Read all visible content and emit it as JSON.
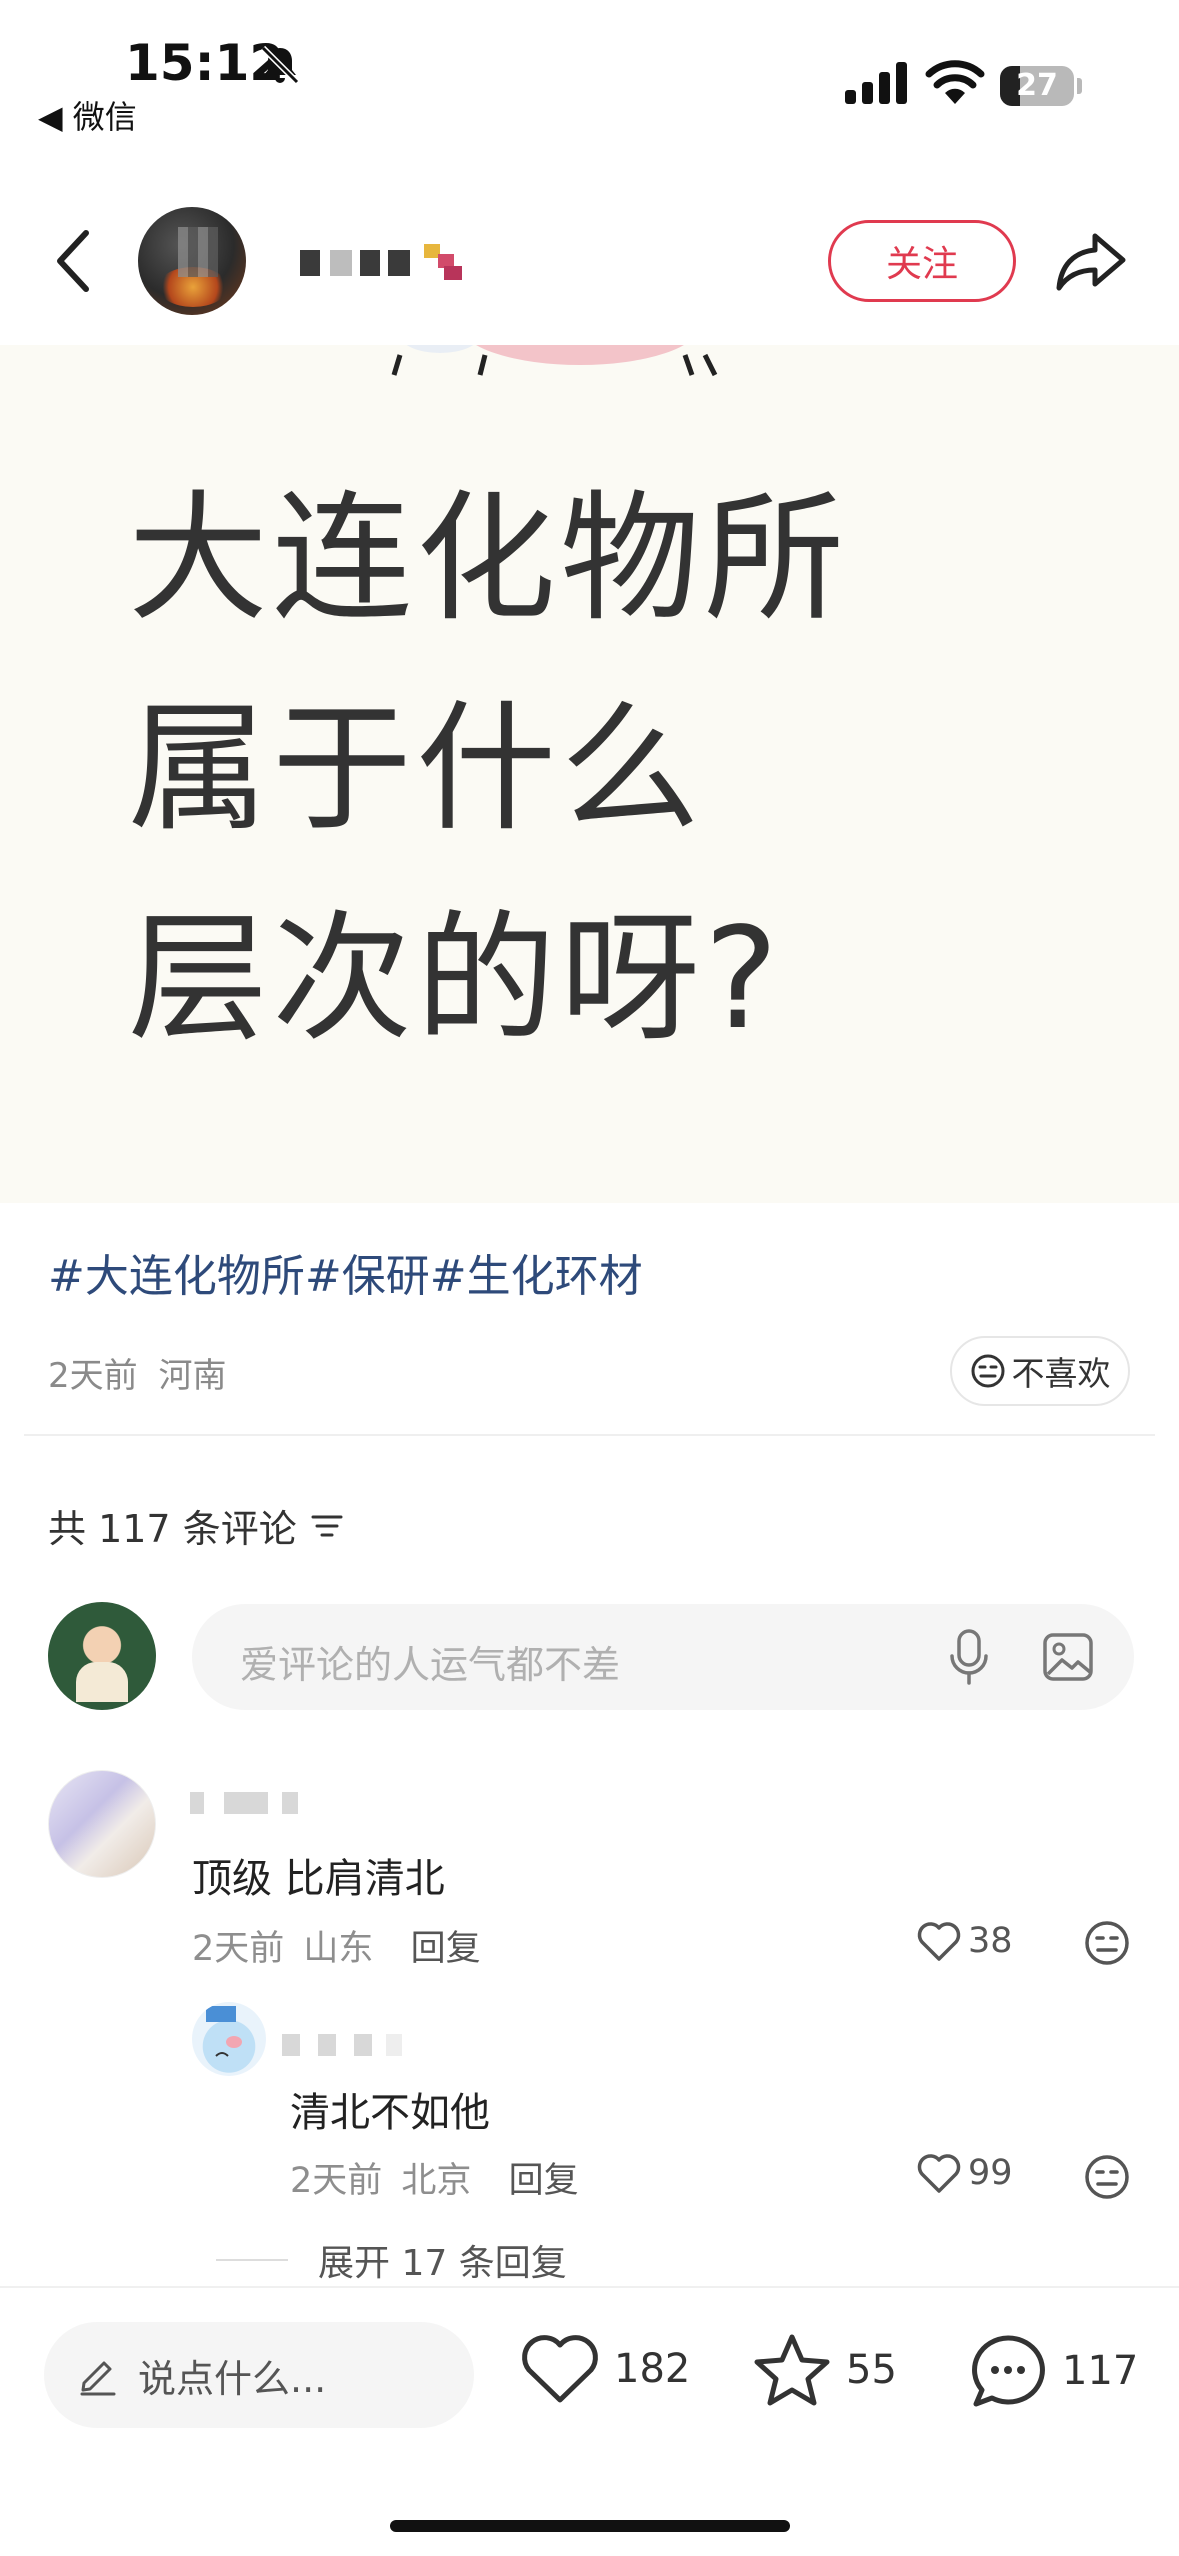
{
  "status_bar": {
    "time": "15:12",
    "back_app": "◀ 微信",
    "battery": "27",
    "battery_level": 0.27
  },
  "header": {
    "follow_label": "关注"
  },
  "post": {
    "image_lines": [
      "大连化物所",
      "属于什么",
      "层次的呀?"
    ],
    "tags": "#大连化物所#保研#生化环材",
    "time": "2天前",
    "location": "河南",
    "dislike_label": "不喜欢"
  },
  "comments": {
    "count_label": "共 117 条评论",
    "input_placeholder": "爱评论的人运气都不差",
    "items": [
      {
        "text": "顶级 比肩清北",
        "time": "2天前",
        "location": "山东",
        "reply_label": "回复",
        "likes": "38"
      },
      {
        "text": "清北不如他",
        "time": "2天前",
        "location": "北京",
        "reply_label": "回复",
        "likes": "99"
      }
    ],
    "expand_label": "展开 17 条回复"
  },
  "bottom_bar": {
    "input_placeholder": "说点什么...",
    "likes": "182",
    "collects": "55",
    "comments": "117"
  },
  "colors": {
    "accent": "#e03a4f",
    "tag": "#2e4a7a",
    "hero_bg": "#fbfaf4"
  },
  "icons": [
    "bell-slash-icon",
    "signal-icon",
    "wifi-icon",
    "battery-icon",
    "back-chevron-icon",
    "share-icon",
    "dislike-face-icon",
    "sort-icon",
    "mic-icon",
    "image-icon",
    "heart-icon",
    "star-icon",
    "chat-bubble-icon",
    "pencil-icon"
  ]
}
